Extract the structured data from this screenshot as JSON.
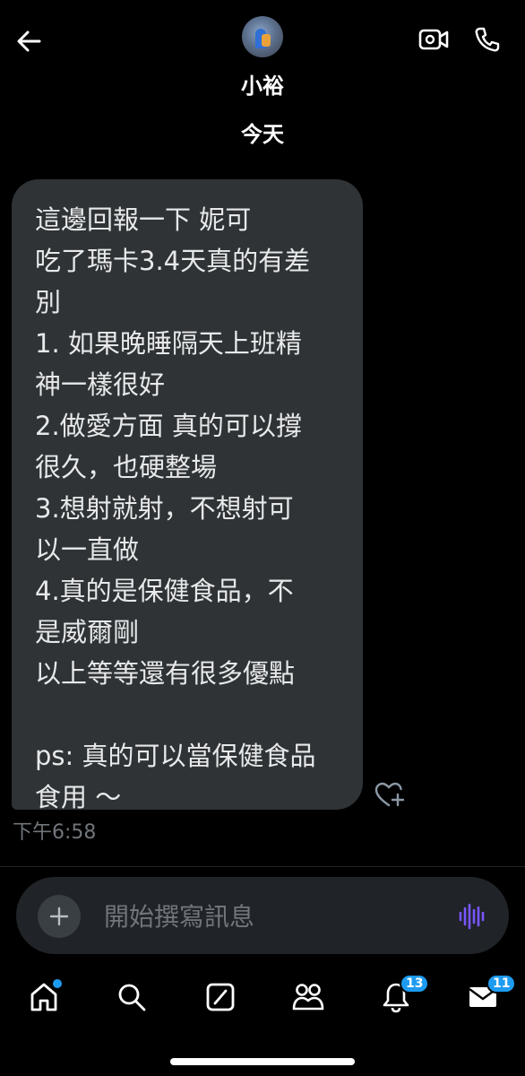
{
  "header": {
    "contact_name": "小裕",
    "date_separator": "今天"
  },
  "message": {
    "lines": [
      "這邊回報一下 妮可",
      "吃了瑪卡3.4天真的有差",
      "別",
      "1. 如果晚睡隔天上班精",
      "神一樣很好",
      "2.做愛方面 真的可以撐",
      "很久，也硬整場",
      "3.想射就射，不想射可",
      "以一直做",
      "4.真的是保健食品，不",
      "是威爾剛",
      "以上等等還有很多優點",
      "",
      "ps: 真的可以當保健食品",
      "食用 ～"
    ],
    "timestamp": "下午6:58"
  },
  "composer": {
    "placeholder": "開始撰寫訊息"
  },
  "nav": {
    "notifications_badge": "13",
    "messages_badge": "11"
  },
  "colors": {
    "background": "#000000",
    "bubble": "#2f3336",
    "composer": "#202327",
    "accent": "#1d9bf0",
    "voice_accent": "#7856ff",
    "muted_text": "#71767b"
  },
  "icons": {
    "back": "back-arrow-icon",
    "video": "video-camera-icon",
    "call": "phone-icon",
    "like": "heart-plus-icon",
    "add": "plus-icon",
    "voice": "voice-wave-icon",
    "home": "home-icon",
    "search": "search-icon",
    "grok": "grok-icon",
    "communities": "communities-icon",
    "notifications": "bell-icon",
    "messages": "mail-icon"
  }
}
